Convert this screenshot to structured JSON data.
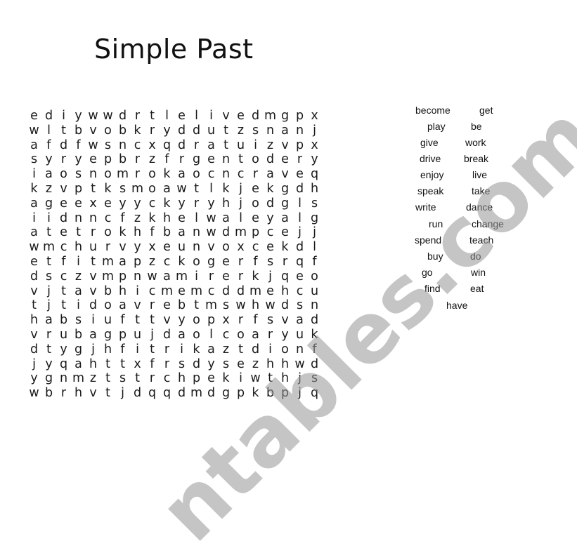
{
  "title": "Simple Past",
  "grid": [
    [
      "e",
      "d",
      "i",
      "y",
      "w",
      "w",
      "d",
      "r",
      "t",
      "l",
      "e",
      "l",
      "i",
      "v",
      "e",
      "d",
      "m",
      "g",
      "p",
      "x"
    ],
    [
      "w",
      "l",
      "t",
      "b",
      "v",
      "o",
      "b",
      "k",
      "r",
      "y",
      "d",
      "d",
      "u",
      "t",
      "z",
      "s",
      "n",
      "a",
      "n",
      "j"
    ],
    [
      "a",
      "f",
      "d",
      "f",
      "w",
      "s",
      "n",
      "c",
      "x",
      "q",
      "d",
      "r",
      "a",
      "t",
      "u",
      "i",
      "z",
      "v",
      "p",
      "x"
    ],
    [
      "s",
      "y",
      "r",
      "y",
      "e",
      "p",
      "b",
      "r",
      "z",
      "f",
      "r",
      "g",
      "e",
      "n",
      "t",
      "o",
      "d",
      "e",
      "r",
      "y"
    ],
    [
      "i",
      "a",
      "o",
      "s",
      "n",
      "o",
      "m",
      "r",
      "o",
      "k",
      "a",
      "o",
      "c",
      "n",
      "c",
      "r",
      "a",
      "v",
      "e",
      "q"
    ],
    [
      "k",
      "z",
      "v",
      "p",
      "t",
      "k",
      "s",
      "m",
      "o",
      "a",
      "w",
      "t",
      "l",
      "k",
      "j",
      "e",
      "k",
      "g",
      "d",
      "h"
    ],
    [
      "a",
      "g",
      "e",
      "e",
      "x",
      "e",
      "y",
      "y",
      "c",
      "k",
      "y",
      "r",
      "y",
      "h",
      "j",
      "o",
      "d",
      "g",
      "l",
      "s"
    ],
    [
      "i",
      "i",
      "d",
      "n",
      "n",
      "c",
      "f",
      "z",
      "k",
      "h",
      "e",
      "l",
      "w",
      "a",
      "l",
      "e",
      "y",
      "a",
      "l",
      "g"
    ],
    [
      "a",
      "t",
      "e",
      "t",
      "r",
      "o",
      "k",
      "h",
      "f",
      "b",
      "a",
      "n",
      "w",
      "d",
      "m",
      "p",
      "c",
      "e",
      "j",
      "j"
    ],
    [
      "w",
      "m",
      "c",
      "h",
      "u",
      "r",
      "v",
      "y",
      "x",
      "e",
      "u",
      "n",
      "v",
      "o",
      "x",
      "c",
      "e",
      "k",
      "d",
      "l"
    ],
    [
      "e",
      "t",
      "f",
      "i",
      "t",
      "m",
      "a",
      "p",
      "z",
      "c",
      "k",
      "o",
      "g",
      "e",
      "r",
      "f",
      "s",
      "r",
      "q",
      "f"
    ],
    [
      "d",
      "s",
      "c",
      "z",
      "v",
      "m",
      "p",
      "n",
      "w",
      "a",
      "m",
      "i",
      "r",
      "e",
      "r",
      "k",
      "j",
      "q",
      "e",
      "o"
    ],
    [
      "v",
      "j",
      "t",
      "a",
      "v",
      "b",
      "h",
      "i",
      "c",
      "m",
      "e",
      "m",
      "c",
      "d",
      "d",
      "m",
      "e",
      "h",
      "c",
      "u"
    ],
    [
      "t",
      "j",
      "t",
      "i",
      "d",
      "o",
      "a",
      "v",
      "r",
      "e",
      "b",
      "t",
      "m",
      "s",
      "w",
      "h",
      "w",
      "d",
      "s",
      "n"
    ],
    [
      "h",
      "a",
      "b",
      "s",
      "i",
      "u",
      "f",
      "t",
      "t",
      "v",
      "y",
      "o",
      "p",
      "x",
      "r",
      "f",
      "s",
      "v",
      "a",
      "d"
    ],
    [
      "v",
      "r",
      "u",
      "b",
      "a",
      "g",
      "p",
      "u",
      "j",
      "d",
      "a",
      "o",
      "l",
      "c",
      "o",
      "a",
      "r",
      "y",
      "u",
      "k"
    ],
    [
      "d",
      "t",
      "y",
      "g",
      "j",
      "h",
      "f",
      "i",
      "t",
      "r",
      "i",
      "k",
      "a",
      "z",
      "t",
      "d",
      "i",
      "o",
      "n",
      "f"
    ],
    [
      "j",
      "y",
      "q",
      "a",
      "h",
      "t",
      "t",
      "x",
      "f",
      "r",
      "s",
      "d",
      "y",
      "s",
      "e",
      "z",
      "h",
      "h",
      "w",
      "d"
    ],
    [
      "y",
      "g",
      "n",
      "m",
      "z",
      "t",
      "s",
      "t",
      "r",
      "c",
      "h",
      "p",
      "e",
      "k",
      "i",
      "w",
      "t",
      "h",
      "j",
      "s"
    ],
    [
      "w",
      "b",
      "r",
      "h",
      "v",
      "t",
      "j",
      "d",
      "q",
      "q",
      "d",
      "m",
      "d",
      "g",
      "p",
      "k",
      "b",
      "p",
      "j",
      "q"
    ]
  ],
  "word_list": [
    "become",
    "get",
    "play",
    "be",
    "give",
    "work",
    "drive",
    "break",
    "enjoy",
    "live",
    "speak",
    "take",
    "write",
    "dance",
    "run",
    "change",
    "spend",
    "teach",
    "buy",
    "do",
    "go",
    "win",
    "find",
    "eat",
    "have"
  ],
  "watermark": "ntables.com"
}
